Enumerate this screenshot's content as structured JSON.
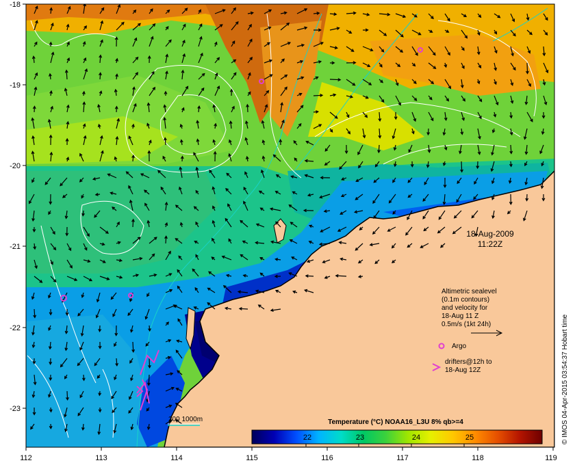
{
  "map": {
    "lon_ticks": [
      "112",
      "113",
      "114",
      "115",
      "116",
      "117",
      "118",
      "119"
    ],
    "lat_ticks": [
      "-18",
      "-19",
      "-20",
      "-21",
      "-22",
      "-23"
    ],
    "timestamp_date": "18-Aug-2009",
    "timestamp_time": "11:22Z",
    "credit": "© IMOS 04-Apr-2015 03:54:37 Hobart time",
    "colors": {
      "land": "#f9c89a",
      "coast": "#000000",
      "contour": "#ffffff",
      "isobath": "#19d3c9",
      "argo": "#e040d0",
      "drifter": "#e040d0"
    }
  },
  "legend": {
    "sealevel_lines": [
      "Altimetric sealevel",
      "(0.1m contours)",
      "and velocity for",
      "18-Aug 11 Z",
      "0.5m/s (1kt 24h)"
    ],
    "argo_label": "Argo",
    "drifter_lines": [
      "drifters@12h to",
      "18-Aug 12Z"
    ],
    "isobath_label": "200  1000m"
  },
  "colorbar": {
    "title": "Temperature (°C) NOAA16_L3U 8% qb>=4",
    "ticks": [
      "22",
      "23",
      "24",
      "25"
    ],
    "colors": [
      "#00005a",
      "#0000b4",
      "#0050ff",
      "#00b4ff",
      "#00dcc8",
      "#00c864",
      "#3cd23c",
      "#a0e600",
      "#e6f000",
      "#ffc800",
      "#ff8c00",
      "#e65000",
      "#b41400",
      "#6e0000"
    ]
  }
}
